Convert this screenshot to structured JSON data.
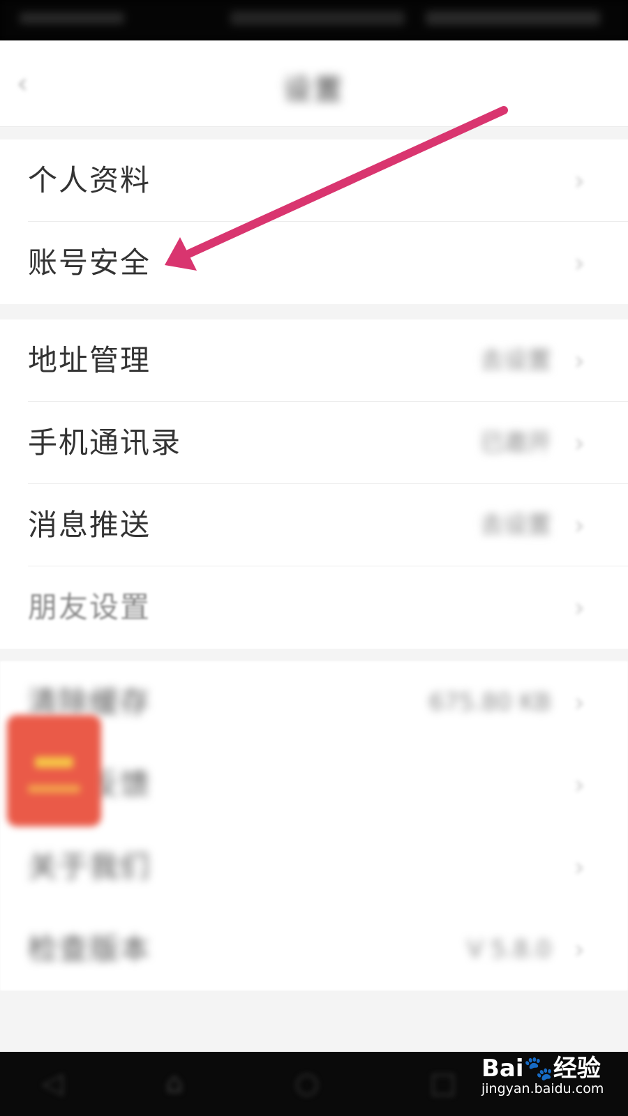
{
  "page": {
    "title": "设置",
    "back_icon": "chevron-left-icon"
  },
  "groups": {
    "profile": {
      "items": [
        {
          "label": "个人资料",
          "value": ""
        },
        {
          "label": "账号安全",
          "value": ""
        }
      ]
    },
    "settings": {
      "items": [
        {
          "label": "地址管理",
          "value": "去设置"
        },
        {
          "label": "手机通讯录",
          "value": "已邀开"
        },
        {
          "label": "消息推送",
          "value": "去设置"
        },
        {
          "label": "朋友设置",
          "value": ""
        }
      ]
    },
    "misc": {
      "items": [
        {
          "label": "清除缓存",
          "value": "675.80 KB"
        },
        {
          "label": "意见反馈",
          "value": ""
        },
        {
          "label": "关于我们",
          "value": ""
        },
        {
          "label": "检查版本",
          "value": "V 5.8.0"
        }
      ]
    }
  },
  "overlay": {
    "arrow_color": "#d9356f",
    "floating_badge_icon": "red-packet-icon"
  },
  "watermark": {
    "logo": "Bai🐾经验",
    "url": "jingyan.baidu.com"
  },
  "navbar": {
    "icons": [
      "nav-back-icon",
      "nav-home-icon",
      "nav-circle-icon",
      "nav-recent-icon"
    ]
  },
  "colors": {
    "background": "#f4f4f4",
    "surface": "#ffffff",
    "text": "#333333",
    "arrow": "#d9356f"
  }
}
